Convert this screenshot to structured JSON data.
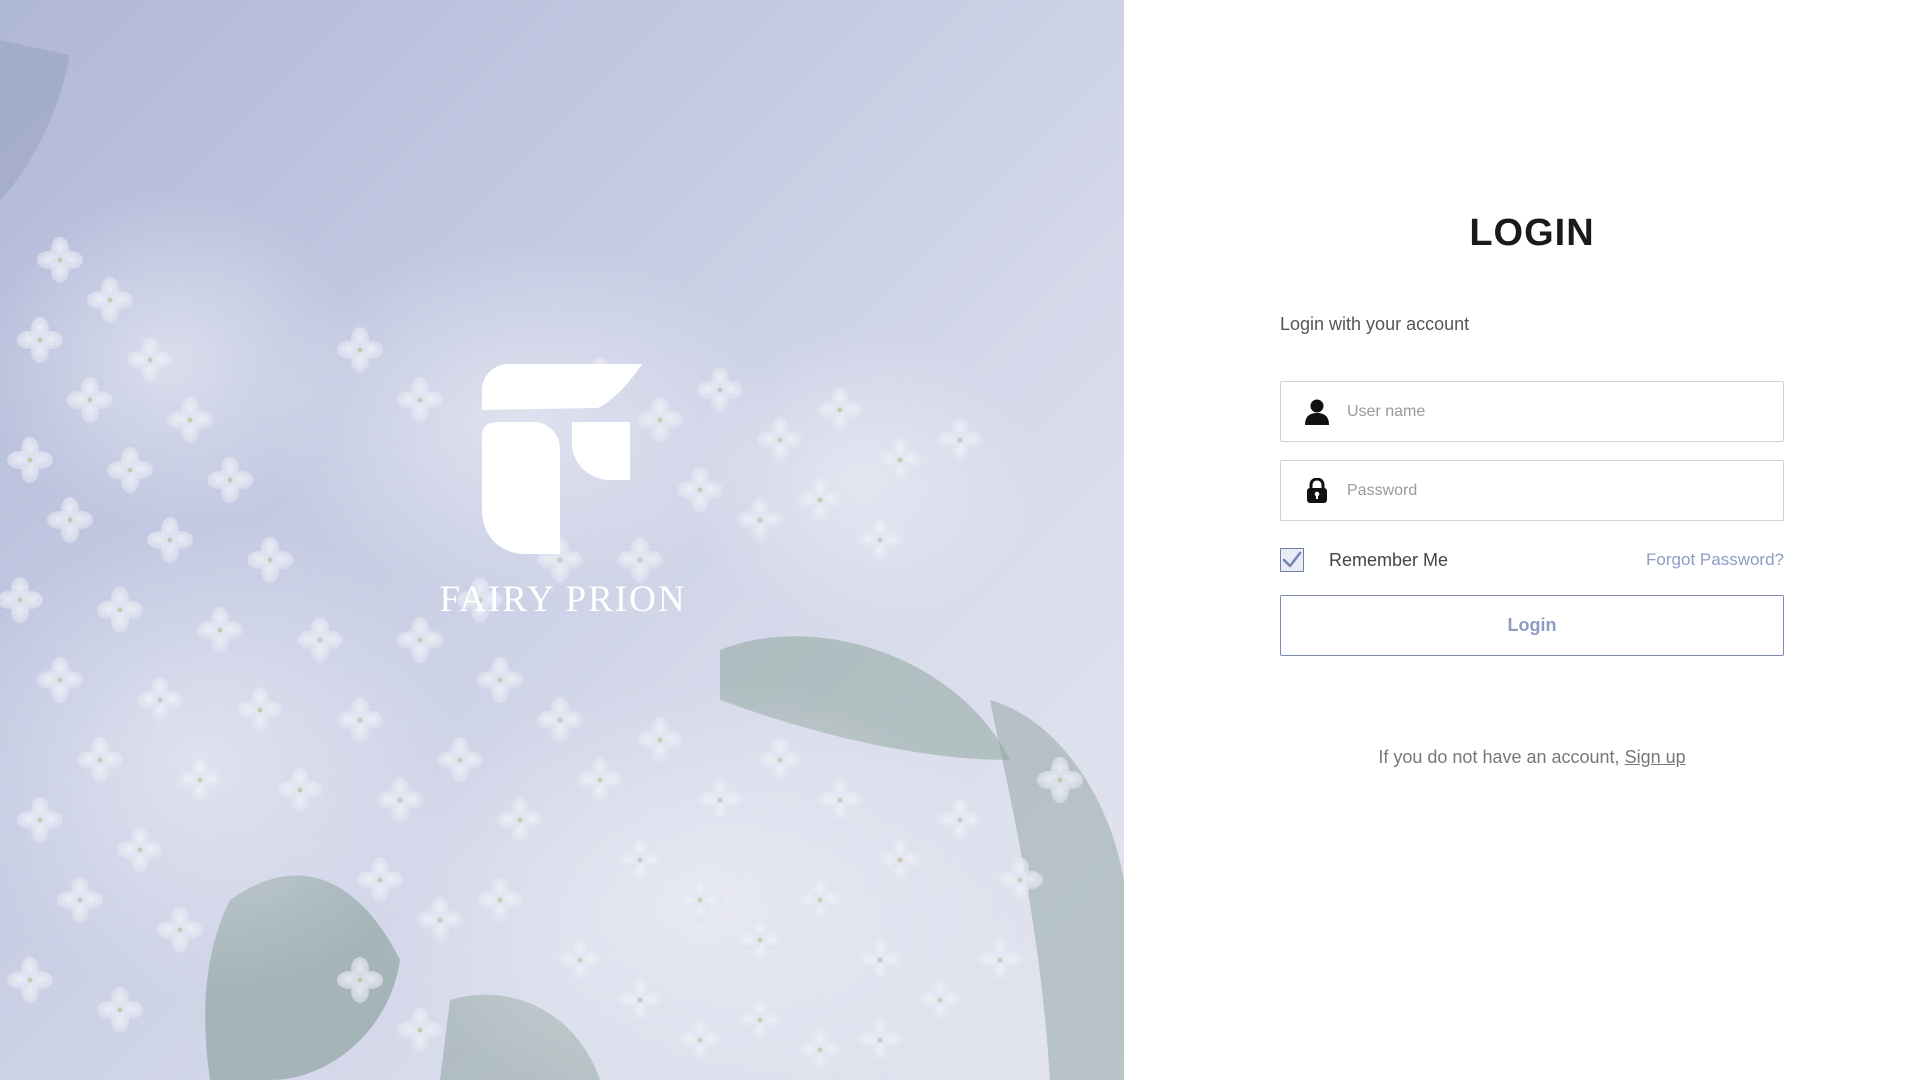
{
  "brand": {
    "name": "FAIRY PRION"
  },
  "login": {
    "title": "LOGIN",
    "subtitle": "Login with your account",
    "username_placeholder": "User name",
    "password_placeholder": "Password",
    "remember_label": "Remember Me",
    "remember_checked": true,
    "forgot_label": "Forgot Password?",
    "submit_label": "Login",
    "signup_prompt": "If you do not have an account, ",
    "signup_label": "Sign up"
  },
  "icons": {
    "logo": "fairy-prion-logo",
    "user": "user-icon",
    "lock": "lock-icon",
    "check": "checkmark-icon"
  },
  "colors": {
    "accent": "#8e9cc4",
    "border": "#cfd3da",
    "hero_tint": "#b7bfdc"
  }
}
